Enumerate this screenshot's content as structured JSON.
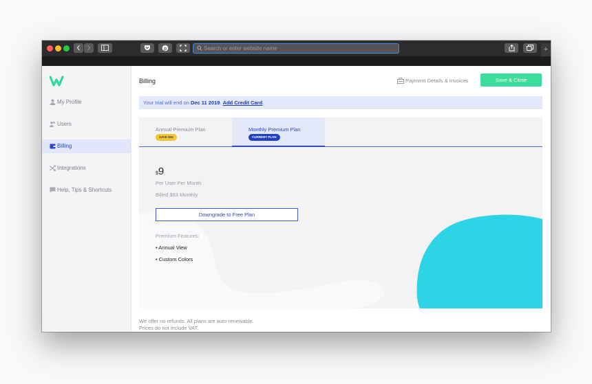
{
  "browser": {
    "url_placeholder": "Search or enter website name",
    "new_tab": "+"
  },
  "sidebar": {
    "logo": "W",
    "items": [
      {
        "label": "My Profile",
        "icon": "user-icon"
      },
      {
        "label": "Users",
        "icon": "users-icon"
      },
      {
        "label": "Billing",
        "icon": "wallet-icon",
        "active": true
      },
      {
        "label": "Integrations",
        "icon": "shuffle-icon"
      },
      {
        "label": "Help, Tips & Shortcuts",
        "icon": "chat-icon"
      }
    ]
  },
  "header": {
    "title": "Billing",
    "payment_link": "Payment Details & Invoices",
    "save_button": "Save & Close"
  },
  "trial_banner": {
    "prefix": "Your trial will end on ",
    "date": "Dec 11 2019",
    "link": "Add Credit Card",
    "suffix": "."
  },
  "plans": {
    "tabs": [
      {
        "label": "Annual Premium Plan",
        "badge": "SAVE $84",
        "active": false
      },
      {
        "label": "Monthly Premium Plan",
        "badge": "CURRENT PLAN",
        "active": true
      }
    ],
    "currency": "$",
    "price": "9",
    "per": "Per User Per Month",
    "billed": "Billed $63 Monthly",
    "downgrade_button": "Downgrade to Free Plan",
    "features_title": "Premium Features:",
    "features": [
      "• Annual View",
      "• Custom Colors"
    ]
  },
  "footer": {
    "line1": "We offer no refunds. All plans are auto-renewable.",
    "line2": "Prices do not include VAT."
  },
  "colors": {
    "accent": "#2a47c8",
    "save_green": "#3bdc9c",
    "blob_cyan": "#2dd4e6",
    "badge_yellow": "#f5c431"
  }
}
